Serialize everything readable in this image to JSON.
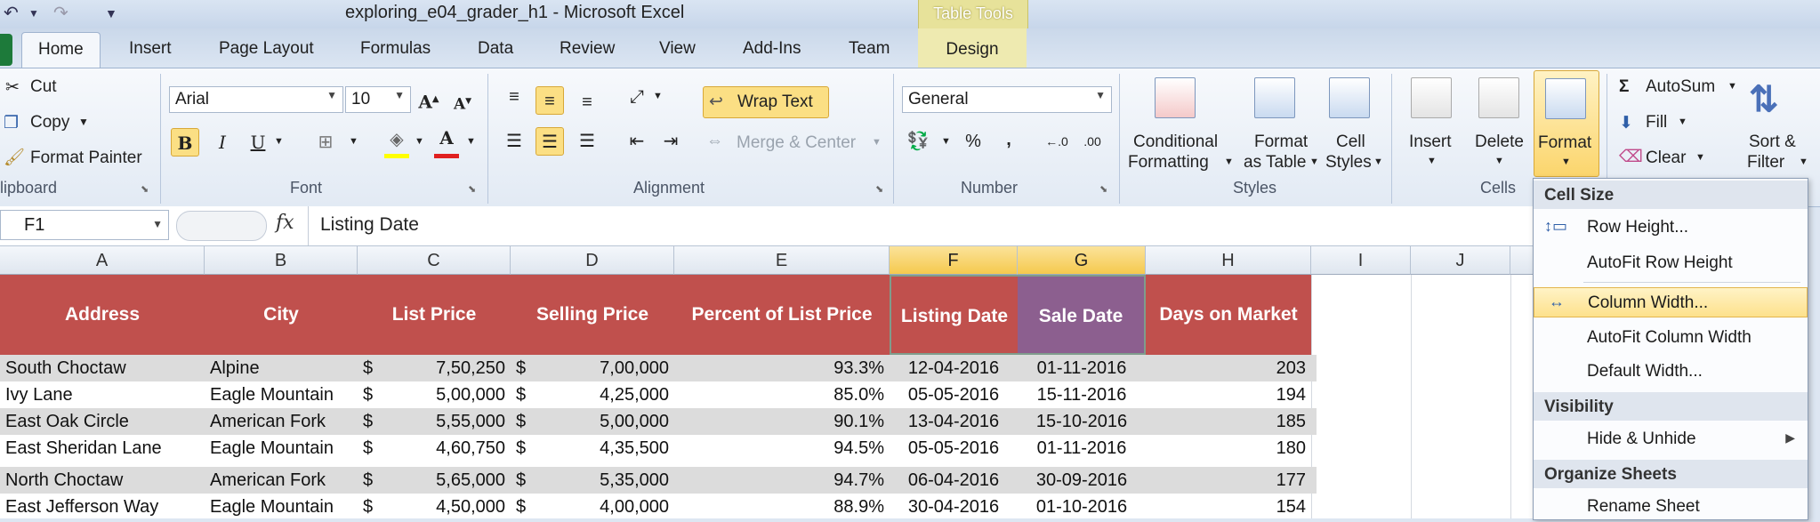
{
  "window": {
    "title": "exploring_e04_grader_h1  -  Microsoft Excel",
    "context_tab_group": "Table Tools"
  },
  "tabs": [
    "Home",
    "Insert",
    "Page Layout",
    "Formulas",
    "Data",
    "Review",
    "View",
    "Add-Ins",
    "Team",
    "Design"
  ],
  "active_tab": "Home",
  "ribbon": {
    "clipboard": {
      "cut": "Cut",
      "copy": "Copy",
      "format_painter": "Format Painter",
      "label": "lipboard"
    },
    "font": {
      "name": "Arial",
      "size": "10",
      "label": "Font"
    },
    "alignment": {
      "wrap_text": "Wrap Text",
      "merge_center": "Merge & Center",
      "label": "Alignment"
    },
    "number": {
      "format": "General",
      "label": "Number"
    },
    "styles": {
      "conditional_1": "Conditional",
      "conditional_2": "Formatting",
      "format_table_1": "Format",
      "format_table_2": "as Table",
      "cell_styles_1": "Cell",
      "cell_styles_2": "Styles",
      "label": "Styles"
    },
    "cells": {
      "insert": "Insert",
      "delete": "Delete",
      "format": "Format",
      "label": "Cells"
    },
    "editing": {
      "autosum": "AutoSum",
      "fill": "Fill",
      "clear": "Clear",
      "sort_1": "Sort &",
      "sort_2": "Filter"
    }
  },
  "formula_bar": {
    "name_box": "F1",
    "fx": "fx",
    "formula": "Listing Date"
  },
  "columns": [
    "A",
    "B",
    "C",
    "D",
    "E",
    "F",
    "G",
    "H",
    "I",
    "J"
  ],
  "selected_columns": [
    "F",
    "G"
  ],
  "table_headers": [
    "Address",
    "City",
    "List Price",
    "Selling Price",
    "Percent of List Price",
    "Listing Date",
    "Sale Date",
    "Days on Market"
  ],
  "rows": [
    {
      "address": "South Choctaw",
      "city": "Alpine",
      "cur1": "$",
      "list": "7,50,250",
      "cur2": "$",
      "sell": "7,00,000",
      "pct": "93.3%",
      "listing": "12-04-2016",
      "sale": "01-11-2016",
      "days": "203"
    },
    {
      "address": "Ivy Lane",
      "city": "Eagle Mountain",
      "cur1": "$",
      "list": "5,00,000",
      "cur2": "$",
      "sell": "4,25,000",
      "pct": "85.0%",
      "listing": "05-05-2016",
      "sale": "15-11-2016",
      "days": "194"
    },
    {
      "address": "East Oak Circle",
      "city": "American Fork",
      "cur1": "$",
      "list": "5,55,000",
      "cur2": "$",
      "sell": "5,00,000",
      "pct": "90.1%",
      "listing": "13-04-2016",
      "sale": "15-10-2016",
      "days": "185"
    },
    {
      "address": "East Sheridan Lane",
      "city": "Eagle Mountain",
      "cur1": "$",
      "list": "4,60,750",
      "cur2": "$",
      "sell": "4,35,500",
      "pct": "94.5%",
      "listing": "05-05-2016",
      "sale": "01-11-2016",
      "days": "180"
    },
    {
      "address": "North Choctaw",
      "city": "American Fork",
      "cur1": "$",
      "list": "5,65,000",
      "cur2": "$",
      "sell": "5,35,000",
      "pct": "94.7%",
      "listing": "06-04-2016",
      "sale": "30-09-2016",
      "days": "177"
    },
    {
      "address": "East Jefferson Way",
      "city": "Eagle Mountain",
      "cur1": "$",
      "list": "4,50,000",
      "cur2": "$",
      "sell": "4,00,000",
      "pct": "88.9%",
      "listing": "30-04-2016",
      "sale": "01-10-2016",
      "days": "154"
    }
  ],
  "format_menu": {
    "cell_size_header": "Cell Size",
    "row_height": "Row Height...",
    "autofit_row": "AutoFit Row Height",
    "column_width": "Column Width...",
    "autofit_column": "AutoFit Column Width",
    "default_width": "Default Width...",
    "visibility_header": "Visibility",
    "hide_unhide": "Hide & Unhide",
    "organize_header": "Organize Sheets",
    "rename_sheet": "Rename Sheet"
  },
  "colors": {
    "table_header": "#c0504d",
    "selected_header": "#8c5f8f",
    "band": "#dcdcdc",
    "highlight": "#fde18c"
  }
}
